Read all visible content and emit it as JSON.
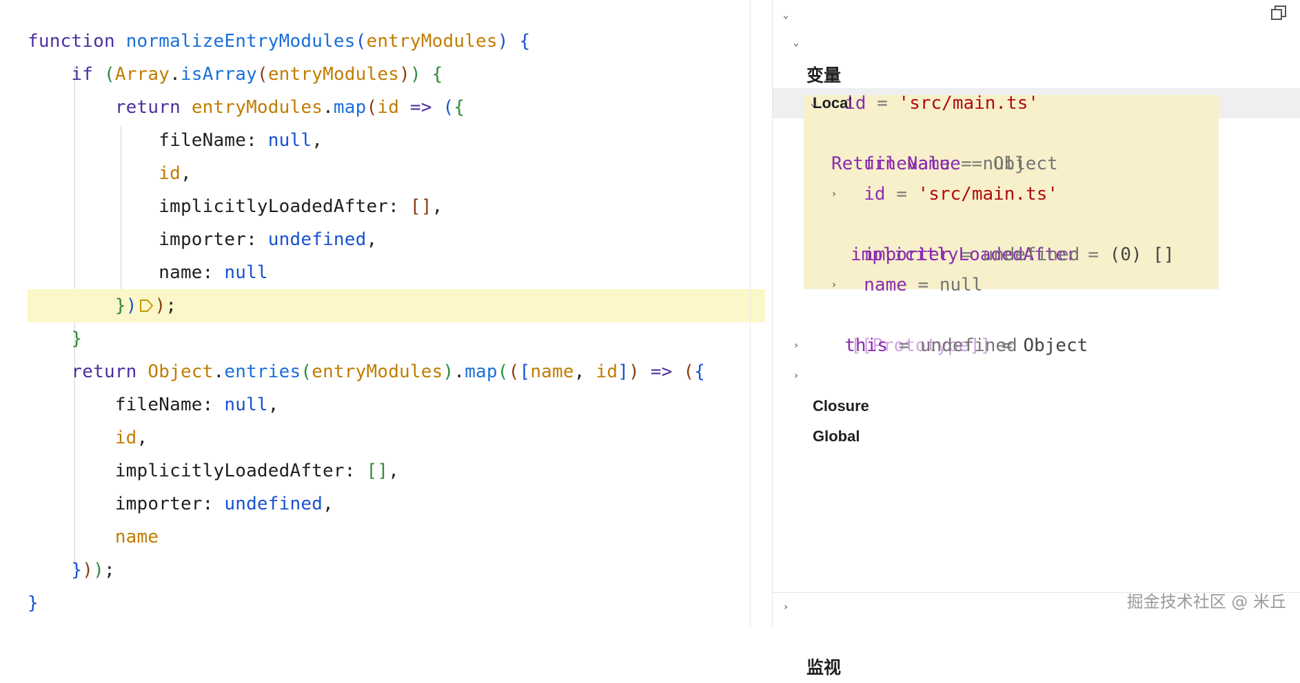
{
  "editor": {
    "lines": [
      [
        {
          "t": "function ",
          "c": "kw"
        },
        {
          "t": "normalizeEntryModules",
          "c": "fn"
        },
        {
          "t": "(",
          "c": "br1"
        },
        {
          "t": "entryModules",
          "c": "var"
        },
        {
          "t": ") ",
          "c": "br1"
        },
        {
          "t": "{",
          "c": "br1"
        }
      ],
      [
        {
          "t": "    if ",
          "c": "kw"
        },
        {
          "t": "(",
          "c": "br2"
        },
        {
          "t": "Array",
          "c": "var"
        },
        {
          "t": ".",
          "c": "punc"
        },
        {
          "t": "isArray",
          "c": "fn"
        },
        {
          "t": "(",
          "c": "br3"
        },
        {
          "t": "entryModules",
          "c": "var"
        },
        {
          "t": ")",
          "c": "br3"
        },
        {
          "t": ") ",
          "c": "br2"
        },
        {
          "t": "{",
          "c": "br2"
        }
      ],
      [
        {
          "t": "        return ",
          "c": "kw"
        },
        {
          "t": "entryModules",
          "c": "var"
        },
        {
          "t": ".",
          "c": "punc"
        },
        {
          "t": "map",
          "c": "fn"
        },
        {
          "t": "(",
          "c": "br3"
        },
        {
          "t": "id",
          "c": "var"
        },
        {
          "t": " => ",
          "c": "kw"
        },
        {
          "t": "(",
          "c": "br1"
        },
        {
          "t": "{",
          "c": "br2"
        }
      ],
      [
        {
          "t": "            fileName",
          "c": "prop"
        },
        {
          "t": ": ",
          "c": "punc"
        },
        {
          "t": "null",
          "c": "lit"
        },
        {
          "t": ",",
          "c": "punc"
        }
      ],
      [
        {
          "t": "            id",
          "c": "var"
        },
        {
          "t": ",",
          "c": "punc"
        }
      ],
      [
        {
          "t": "            implicitlyLoadedAfter",
          "c": "prop"
        },
        {
          "t": ": ",
          "c": "punc"
        },
        {
          "t": "[]",
          "c": "br3"
        },
        {
          "t": ",",
          "c": "punc"
        }
      ],
      [
        {
          "t": "            importer",
          "c": "prop"
        },
        {
          "t": ": ",
          "c": "punc"
        },
        {
          "t": "undefined",
          "c": "lit"
        },
        {
          "t": ",",
          "c": "punc"
        }
      ],
      [
        {
          "t": "            name",
          "c": "prop"
        },
        {
          "t": ": ",
          "c": "punc"
        },
        {
          "t": "null",
          "c": "lit"
        }
      ],
      [
        {
          "t": "        }",
          "c": "br2"
        },
        {
          "t": ")",
          "c": "br1"
        },
        {
          "t": "@BP",
          "c": "bp"
        },
        {
          "t": ")",
          "c": "br3"
        },
        {
          "t": ";",
          "c": "punc"
        }
      ],
      [
        {
          "t": "    }",
          "c": "br2"
        }
      ],
      [
        {
          "t": "    return ",
          "c": "kw"
        },
        {
          "t": "Object",
          "c": "var"
        },
        {
          "t": ".",
          "c": "punc"
        },
        {
          "t": "entries",
          "c": "fn"
        },
        {
          "t": "(",
          "c": "br2"
        },
        {
          "t": "entryModules",
          "c": "var"
        },
        {
          "t": ")",
          "c": "br2"
        },
        {
          "t": ".",
          "c": "punc"
        },
        {
          "t": "map",
          "c": "fn"
        },
        {
          "t": "(",
          "c": "br2"
        },
        {
          "t": "(",
          "c": "br3"
        },
        {
          "t": "[",
          "c": "br1"
        },
        {
          "t": "name",
          "c": "var"
        },
        {
          "t": ", ",
          "c": "punc"
        },
        {
          "t": "id",
          "c": "var"
        },
        {
          "t": "]",
          "c": "br1"
        },
        {
          "t": ")",
          "c": "br3"
        },
        {
          "t": " => ",
          "c": "kw"
        },
        {
          "t": "(",
          "c": "br3"
        },
        {
          "t": "{",
          "c": "br1"
        }
      ],
      [
        {
          "t": "        fileName",
          "c": "prop"
        },
        {
          "t": ": ",
          "c": "punc"
        },
        {
          "t": "null",
          "c": "lit"
        },
        {
          "t": ",",
          "c": "punc"
        }
      ],
      [
        {
          "t": "        id",
          "c": "var"
        },
        {
          "t": ",",
          "c": "punc"
        }
      ],
      [
        {
          "t": "        implicitlyLoadedAfter",
          "c": "prop"
        },
        {
          "t": ": ",
          "c": "punc"
        },
        {
          "t": "[]",
          "c": "br2"
        },
        {
          "t": ",",
          "c": "punc"
        }
      ],
      [
        {
          "t": "        importer",
          "c": "prop"
        },
        {
          "t": ": ",
          "c": "punc"
        },
        {
          "t": "undefined",
          "c": "lit"
        },
        {
          "t": ",",
          "c": "punc"
        }
      ],
      [
        {
          "t": "        name",
          "c": "var"
        }
      ],
      [
        {
          "t": "    }",
          "c": "br1"
        },
        {
          "t": ")",
          "c": "br3"
        },
        {
          "t": ")",
          "c": "br2"
        },
        {
          "t": ";",
          "c": "punc"
        }
      ],
      [
        {
          "t": "}",
          "c": "br1"
        }
      ]
    ]
  },
  "panel": {
    "variables_title": "变量",
    "local_title": "Local",
    "local_id_name": "id",
    "local_id_value": "'src/main.ts'",
    "return_value_name": "Return value",
    "return_value_type": "Object",
    "ret_fileName_name": "fileName",
    "ret_fileName_value": "null",
    "ret_id_name": "id",
    "ret_id_value": "'src/main.ts'",
    "ret_ila_name": "implicitlyLoadedAfter",
    "ret_ila_value": "(0) []",
    "ret_importer_name": "importer",
    "ret_importer_value": "undefined",
    "ret_name_name": "name",
    "ret_name_value": "null",
    "ret_proto_name": "[[Prototype]]",
    "ret_proto_value": "Object",
    "this_name": "this",
    "this_value": "undefined",
    "closure_title": "Closure",
    "global_title": "Global",
    "watch_title": "监视",
    "eq": "="
  },
  "watermark": "掘金技术社区 @ 米丘",
  "icons": {
    "expand": "chevron-down-icon",
    "collapse": "chevron-right-icon",
    "breakpoint": "breakpoint-arrow-icon",
    "restore": "restore-window-icon"
  }
}
